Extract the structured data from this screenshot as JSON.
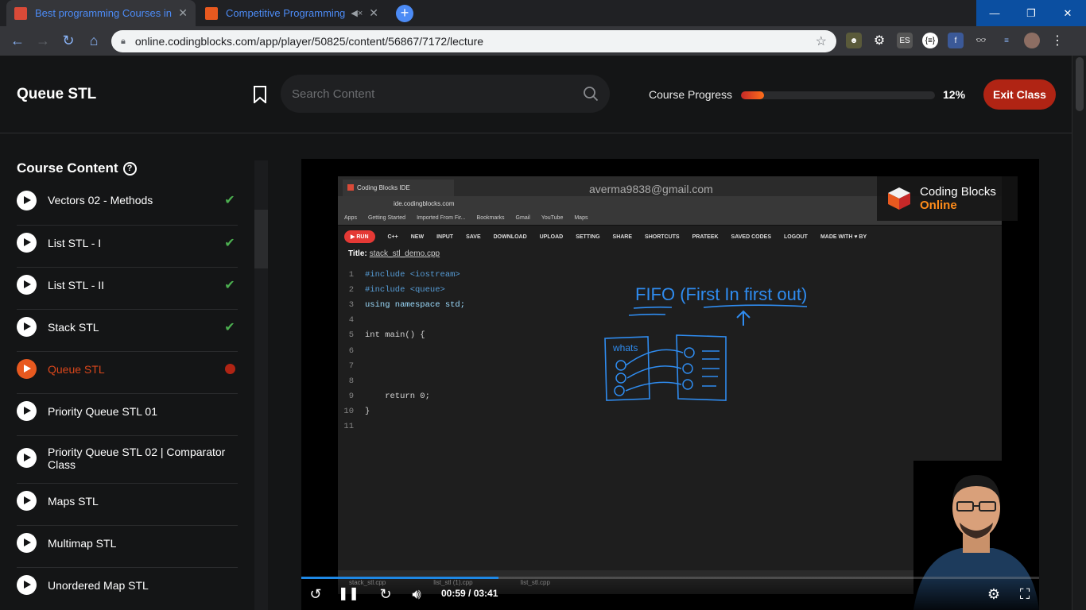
{
  "browser": {
    "tabs": [
      {
        "title": "Best programming Courses in De",
        "favicon_color": "#d94a38"
      },
      {
        "title": "Competitive Programming |",
        "favicon_color": "#e8591f"
      }
    ],
    "url": "online.codingblocks.com/app/player/50825/content/56867/7172/lecture",
    "window_buttons": [
      "—",
      "❐",
      "✕"
    ],
    "extensions": [
      "ES",
      "{≡}",
      "f"
    ]
  },
  "header": {
    "title": "Queue STL",
    "search_placeholder": "Search Content",
    "progress_label": "Course Progress",
    "progress_percent": "12%",
    "progress_value": 0.12,
    "exit_label": "Exit Class"
  },
  "sidebar": {
    "title": "Course Content",
    "items": [
      {
        "label": "Vectors 02 - Methods",
        "status": "done"
      },
      {
        "label": "List STL - I",
        "status": "done"
      },
      {
        "label": "List STL - II",
        "status": "done"
      },
      {
        "label": "Stack STL",
        "status": "done"
      },
      {
        "label": "Queue STL",
        "status": "active"
      },
      {
        "label": "Priority Queue STL 01",
        "status": "none"
      },
      {
        "label": "Priority Queue STL 02 | Comparator Class",
        "status": "none"
      },
      {
        "label": "Maps STL",
        "status": "none"
      },
      {
        "label": "Multimap STL",
        "status": "none"
      },
      {
        "label": "Unordered Map STL",
        "status": "none"
      }
    ]
  },
  "video": {
    "ide_tab": "Coding Blocks IDE",
    "ide_url": "ide.codingblocks.com",
    "watermark_email": "averma9838@gmail.com",
    "bookmarks": [
      "Apps",
      "Getting Started",
      "Imported From Fir...",
      "Bookmarks",
      "Gmail",
      "YouTube",
      "Maps"
    ],
    "menu": [
      "C++",
      "NEW",
      "INPUT",
      "SAVE",
      "DOWNLOAD",
      "UPLOAD",
      "SETTING",
      "SHARE",
      "SHORTCUTS",
      "PRATEEK",
      "SAVED CODES",
      "LOGOUT",
      "MADE WITH ♥ BY"
    ],
    "run_label": "RUN",
    "title_label": "Title:",
    "title_file": "stack_stl_demo.cpp",
    "code": [
      {
        "n": "1",
        "t": "#include <iostream>"
      },
      {
        "n": "2",
        "t": "#include <queue>"
      },
      {
        "n": "3",
        "t": "using namespace std;"
      },
      {
        "n": "4",
        "t": ""
      },
      {
        "n": "5",
        "t": "int main() {"
      },
      {
        "n": "6",
        "t": ""
      },
      {
        "n": "7",
        "t": ""
      },
      {
        "n": "8",
        "t": ""
      },
      {
        "n": "9",
        "t": "    return 0;"
      },
      {
        "n": "10",
        "t": "}"
      },
      {
        "n": "11",
        "t": ""
      }
    ],
    "annotation": "FIFO (First In first out)",
    "sketch_label": "whats",
    "footer_files": [
      "stack_stl.cpp",
      "list_stl (1).cpp",
      "list_stl.cpp"
    ],
    "logo_name": "Coding Blocks",
    "logo_sub": "Online",
    "time": "00:59 / 03:41",
    "played_fraction": 0.267
  }
}
